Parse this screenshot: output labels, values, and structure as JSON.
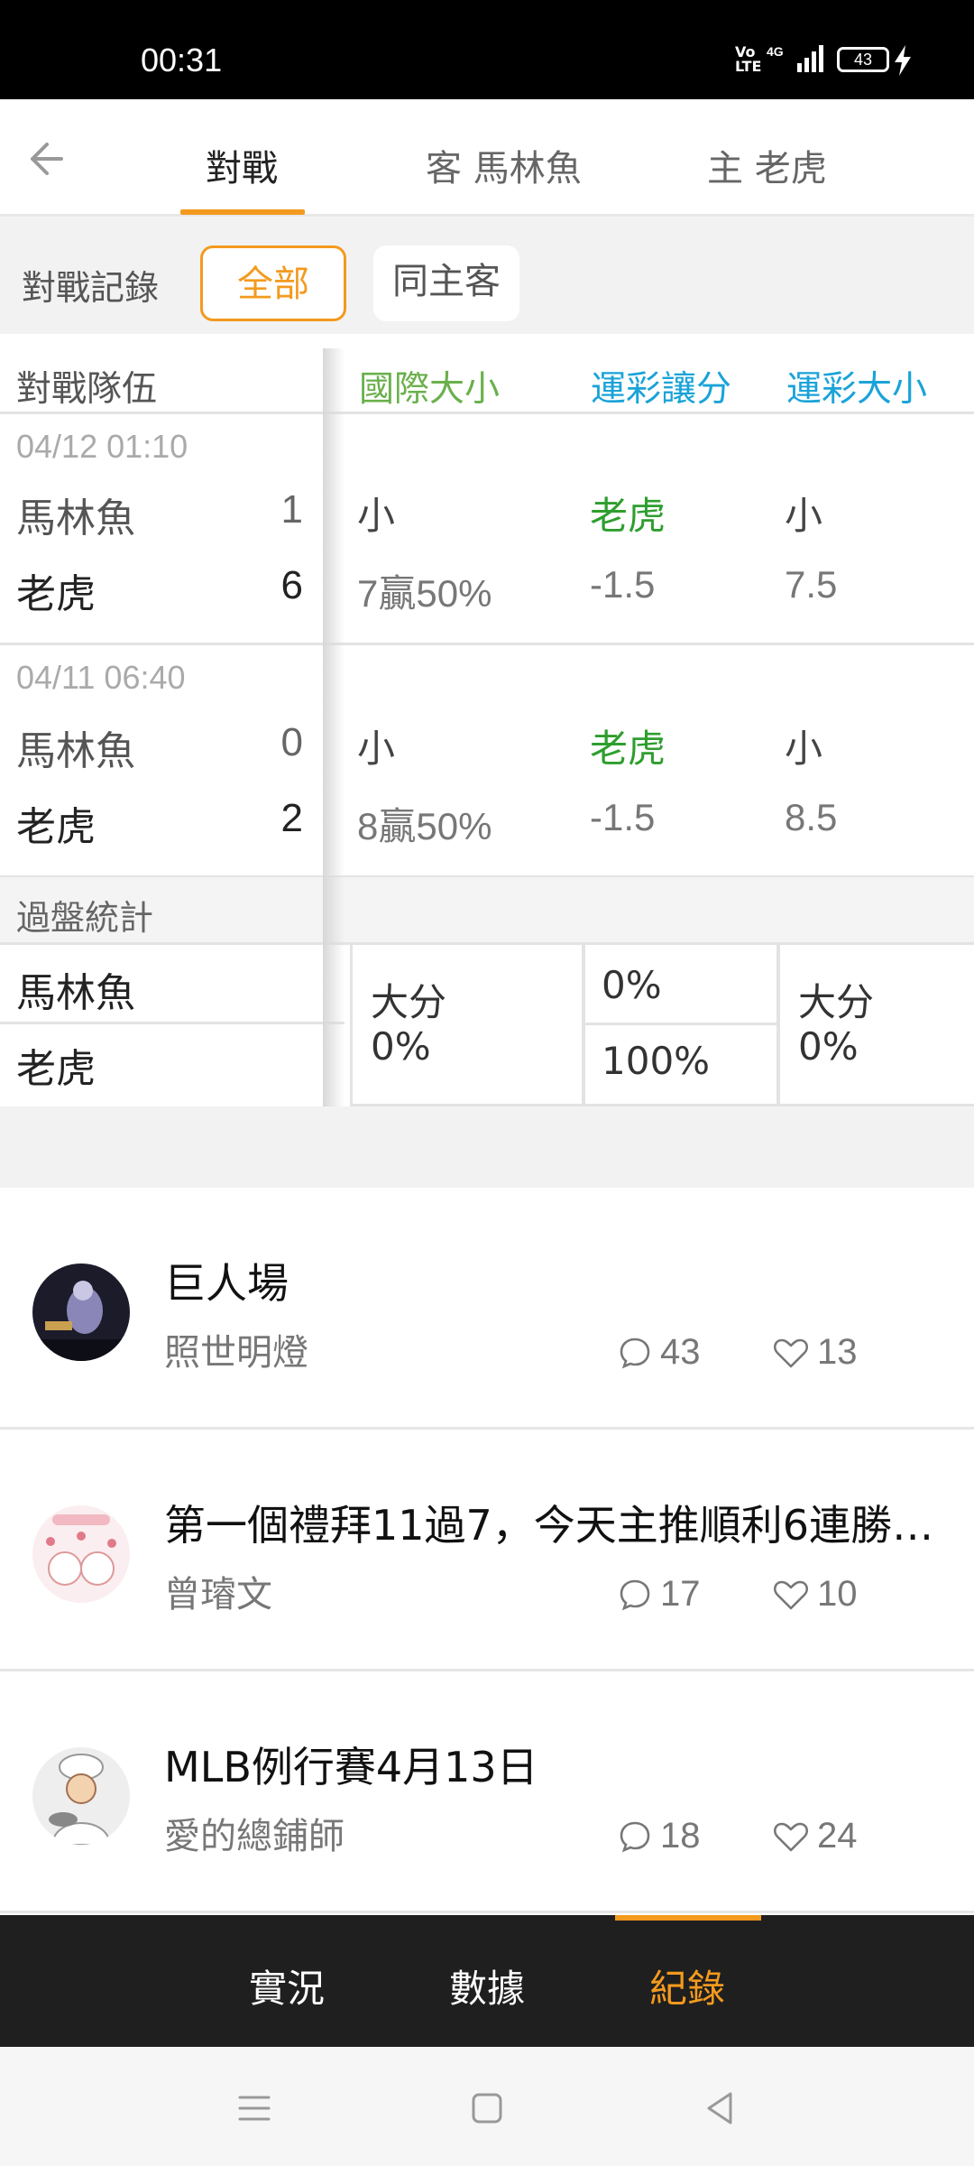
{
  "status_bar": {
    "time": "00:31",
    "network_badge": "Vo LTE",
    "network_type": "4G",
    "battery": "43"
  },
  "top_nav": {
    "tabs": [
      {
        "label": "對戰",
        "active": true
      },
      {
        "label": "客 馬林魚",
        "active": false
      },
      {
        "label": "主 老虎",
        "active": false
      }
    ]
  },
  "filter": {
    "label": "對戰記錄",
    "chips": [
      {
        "label": "全部",
        "active": true
      },
      {
        "label": "同主客",
        "active": false
      }
    ]
  },
  "table": {
    "headers": {
      "team": "對戰隊伍",
      "intl_total": "國際大小",
      "sports_spread": "運彩讓分",
      "sports_total": "運彩大小"
    },
    "matches": [
      {
        "date": "04/12 01:10",
        "away": {
          "name": "馬林魚",
          "score": "1"
        },
        "home": {
          "name": "老虎",
          "score": "6"
        },
        "intl_result": "小",
        "intl_line": "7贏50%",
        "spread_result": "老虎",
        "spread_line": "-1.5",
        "total_result": "小",
        "total_line": "7.5"
      },
      {
        "date": "04/11 06:40",
        "away": {
          "name": "馬林魚",
          "score": "0"
        },
        "home": {
          "name": "老虎",
          "score": "2"
        },
        "intl_result": "小",
        "intl_line": "8贏50%",
        "spread_result": "老虎",
        "spread_line": "-1.5",
        "total_result": "小",
        "total_line": "8.5"
      }
    ],
    "stats": {
      "title": "過盤統計",
      "away_team": "馬林魚",
      "home_team": "老虎",
      "intl": {
        "label": "大分",
        "value": "0%"
      },
      "spread": {
        "away": "0%",
        "home": "100%"
      },
      "total": {
        "label": "大分",
        "value": "0%"
      }
    }
  },
  "posts": [
    {
      "title": "巨人場",
      "author": "照世明燈",
      "comments": "43",
      "likes": "13"
    },
    {
      "title": "第一個禮拜11過7，今天主推順利6連勝…",
      "author": "曾璿文",
      "comments": "17",
      "likes": "10"
    },
    {
      "title": "MLB例行賽4月13日",
      "author": "愛的總鋪師",
      "comments": "18",
      "likes": "24"
    }
  ],
  "bottom_tabs": [
    {
      "label": "實況",
      "active": false
    },
    {
      "label": "數據",
      "active": false
    },
    {
      "label": "紀錄",
      "active": true
    }
  ],
  "colors": {
    "accent": "#f39a1e",
    "intl_header": "#6ab04c",
    "sports_header": "#1aa3d8",
    "win_team": "#2e9e2e"
  }
}
